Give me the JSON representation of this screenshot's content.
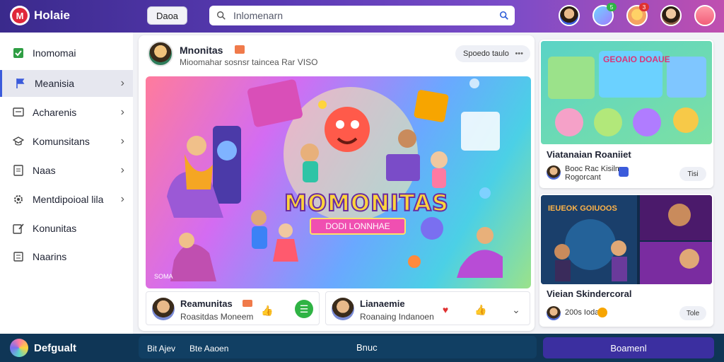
{
  "header": {
    "app_title": "Holaie",
    "logo_letters": "M",
    "button_label": "Daoa",
    "search_placeholder": "Inlomenarn",
    "badges": [
      "5",
      "3"
    ]
  },
  "sidebar": {
    "items": [
      {
        "label": "Inomomai",
        "icon": "square-icon"
      },
      {
        "label": "Meanisia",
        "icon": "flag-icon"
      },
      {
        "label": "Acharenis",
        "icon": "screen-icon"
      },
      {
        "label": "Komunsitans",
        "icon": "graduation-cap-icon"
      },
      {
        "label": "Naas",
        "icon": "document-icon"
      },
      {
        "label": "Mentdipoioal lila",
        "icon": "gear-icon"
      },
      {
        "label": "Konunitas",
        "icon": "compose-icon"
      },
      {
        "label": "Naarins",
        "icon": "users-icon"
      }
    ]
  },
  "post": {
    "title": "Mnonitas",
    "subtitle": "Mioomahar sosnsr taincea Rar VISO",
    "action_label": "Spoedo taulo",
    "hero_title": "MOMONITAS",
    "hero_banner": "DODI LONNHAE",
    "hero_caption": "SOMA"
  },
  "subcards": [
    {
      "title": "Reamunitas",
      "text": "Roasitdas Moneem"
    },
    {
      "title": "Lianaemie",
      "text": "Roanaing Indanoen"
    }
  ],
  "right_cards": [
    {
      "title": "Viatanaian Roaniiet",
      "text1": "Booc Rac Kisilme",
      "text2": "Rogorcant",
      "button": "Tisi",
      "image_text": "GEOAIO  DOAUE"
    },
    {
      "title": "Vieian Skindercoral",
      "text1": "200s Ioda",
      "text2": "",
      "button": "Tole",
      "image_text": "IEUEOK  GOIUOOS"
    }
  ],
  "footer": {
    "title": "Defgualt",
    "link1": "Bit Ajev",
    "link2": "Bte Aaoen",
    "center_label": "Bnuc",
    "button_label": "Boamenl"
  },
  "colors": {
    "accent": "#3b5bdb",
    "header_start": "#3a2a8c",
    "header_end": "#c04fb0",
    "footer": "#0f3656"
  }
}
